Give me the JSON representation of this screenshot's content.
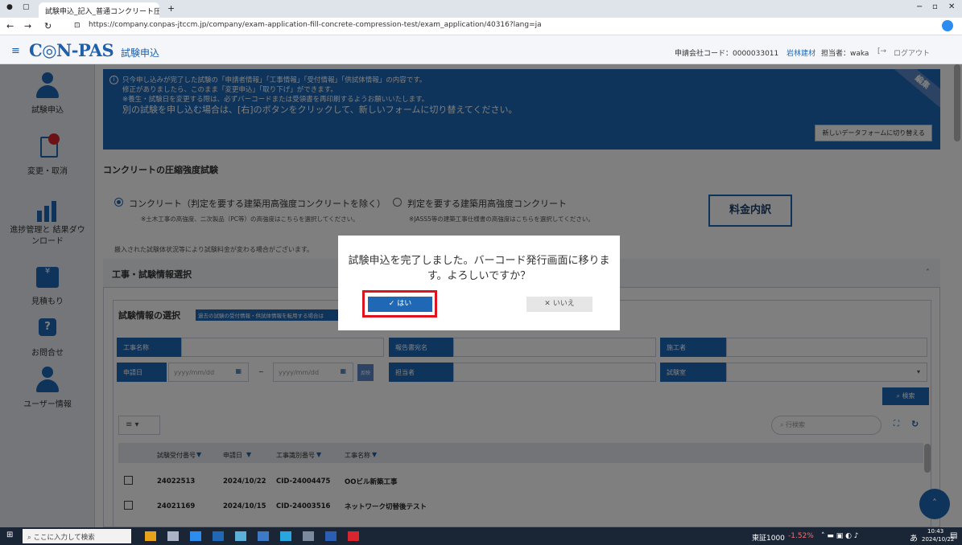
{
  "browser": {
    "tab_title": "試験申込_記入_普通コンクリート圧縮",
    "url": "https://company.conpas-jtccm.jp/company/exam-application-fill-concrete-compression-test/exam_application/40316?lang=ja"
  },
  "app": {
    "logo": "C◎N-PAS",
    "subtitle": "試験申込",
    "company_code": "申請会社コード：0000033011",
    "company_name": "岩林建材",
    "user": "担当者：waka",
    "logout": "ログアウト"
  },
  "sidebar": {
    "items": [
      {
        "label": "試験申込",
        "icon": "user-icon"
      },
      {
        "label": "変更・取消",
        "icon": "edit-cancel-icon"
      },
      {
        "label": "進捗管理と 結果ダウンロード",
        "icon": "chart-icon"
      },
      {
        "label": "見積もり",
        "icon": "yen-icon"
      },
      {
        "label": "お問合せ",
        "icon": "question-icon"
      },
      {
        "label": "ユーザー情報",
        "icon": "user-info-icon"
      }
    ]
  },
  "banner": {
    "line1": "只今申し込みが完了した試験の「申請者情報」「工事情報」「受付情報」「供試体情報」の内容です。",
    "line2": "修正がありましたら、このまま「変更申込」「取り下げ」ができます。",
    "line3": "※養生・試験日を変更する際は、必ずバーコードまたは受領書を再印刷するようお願いいたします。",
    "line4": "別の試験を申し込む場合は、[右]のボタンをクリックして、新しいフォームに切り替えてください。",
    "corner": "編集",
    "button": "新しいデータフォームに切り替える"
  },
  "section_title": "コンクリートの圧縮強度試験",
  "radio": {
    "opt1": "コンクリート（判定を要する建築用高強度コンクリートを除く）",
    "opt1_note": "※土木工事の高強度、二次製品（PC等）の高強度はこちらを選択してください。",
    "opt2": "判定を要する建築用高強度コンクリート",
    "opt2_note": "※JASS5等の建築工事仕様書の高強度はこちらを選択してください。"
  },
  "price_button": "料金内訳",
  "notice": "搬入された試験体状況等により試験料金が変わる場合がございます。",
  "panel_title": "工事・試験情報選択",
  "sub_panel_title": "試験情報の選択",
  "sub_panel_badge": "過去の試験の受付情報・供試体情報を転用する場合は",
  "form": {
    "koji_name": "工事名称",
    "report_name": "報告書宛名",
    "contractor": "施工者",
    "apply_date": "申請日",
    "date_ph": "yyyy/mm/dd",
    "tilde": "~",
    "clear": "反映",
    "person": "担当者",
    "lab": "試験室",
    "search": "検索",
    "row_search_ph": "行検索"
  },
  "table": {
    "headers": [
      "試験受付番号",
      "申請日",
      "工事識別番号",
      "工事名称"
    ],
    "rows": [
      [
        "24022513",
        "2024/10/22",
        "CID-24004475",
        "OOビル新築工事"
      ],
      [
        "24021169",
        "2024/10/15",
        "CID-24003516",
        "ネットワーク切替後テスト"
      ]
    ]
  },
  "dialog": {
    "message": "試験申込を完了しました。バーコード発行画面に移ります。よろしいですか？",
    "yes": "はい",
    "no": "いいえ"
  },
  "taskbar": {
    "search": "ここに入力して検索",
    "stock": "東証1000",
    "stock_change": "-1.52%",
    "ime": "あ",
    "time": "10:43",
    "date": "2024/10/22"
  }
}
